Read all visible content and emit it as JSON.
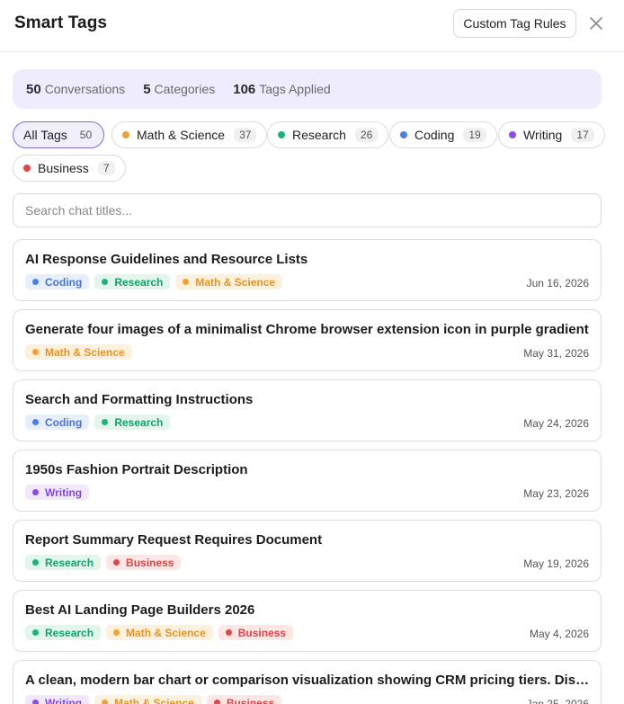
{
  "header": {
    "title": "Smart Tags",
    "rules_button": "Custom Tag Rules"
  },
  "stats": [
    {
      "value": "50",
      "label": "Conversations"
    },
    {
      "value": "5",
      "label": "Categories"
    },
    {
      "value": "106",
      "label": "Tags Applied"
    }
  ],
  "filters": [
    {
      "label": "All Tags",
      "count": "50",
      "active": true
    },
    {
      "label": "Math & Science",
      "count": "37",
      "color": "#f0a236"
    },
    {
      "label": "Research",
      "count": "26",
      "color": "#1db27a"
    },
    {
      "label": "Coding",
      "count": "19",
      "color": "#4a7fe6"
    },
    {
      "label": "Writing",
      "count": "17",
      "color": "#8a4fe0"
    },
    {
      "label": "Business",
      "count": "7",
      "color": "#e04848"
    }
  ],
  "search": {
    "placeholder": "Search chat titles..."
  },
  "tag_styles": {
    "Coding": {
      "dot": "#4a7fe6",
      "bg": "#e8effc",
      "fg": "#4a73d6"
    },
    "Research": {
      "dot": "#1db27a",
      "bg": "#e2f6ec",
      "fg": "#17a06a"
    },
    "Math & Science": {
      "dot": "#f0a236",
      "bg": "#fdf0dc",
      "fg": "#e2952b"
    },
    "Writing": {
      "dot": "#8a4fe0",
      "bg": "#f1e8fc",
      "fg": "#8548d8"
    },
    "Business": {
      "dot": "#e04848",
      "bg": "#fde6e6",
      "fg": "#d94545"
    }
  },
  "conversations": [
    {
      "title": "AI Response Guidelines and Resource Lists",
      "tags": [
        "Coding",
        "Research",
        "Math & Science"
      ],
      "date": "Jun 16, 2026"
    },
    {
      "title": "Generate four images of a minimalist Chrome browser extension icon in purple gradient",
      "tags": [
        "Math & Science"
      ],
      "date": "May 31, 2026"
    },
    {
      "title": "Search and Formatting Instructions",
      "tags": [
        "Coding",
        "Research"
      ],
      "date": "May 24, 2026"
    },
    {
      "title": "1950s Fashion Portrait Description",
      "tags": [
        "Writing"
      ],
      "date": "May 23, 2026"
    },
    {
      "title": "Report Summary Request Requires Document",
      "tags": [
        "Research",
        "Business"
      ],
      "date": "May 19, 2026"
    },
    {
      "title": "Best AI Landing Page Builders 2026",
      "tags": [
        "Research",
        "Math & Science",
        "Business"
      ],
      "date": "May 4, 2026"
    },
    {
      "title": "A clean, modern bar chart or comparison visualization showing CRM pricing tiers. Display",
      "tags": [
        "Writing",
        "Math & Science",
        "Business"
      ],
      "date": "Jan 25, 2026"
    }
  ]
}
